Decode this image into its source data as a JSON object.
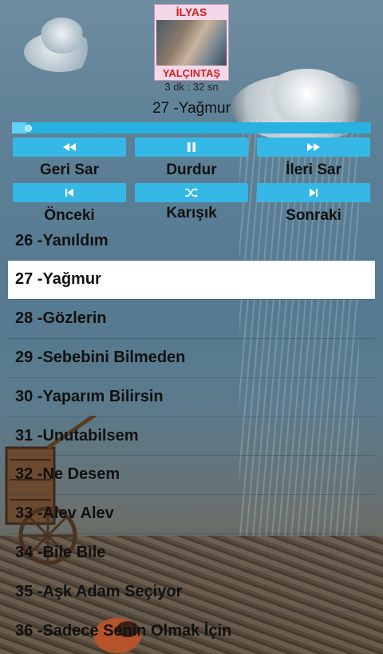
{
  "album": {
    "artist_line1": "İLYAS",
    "artist_line2": "YALÇINTAŞ"
  },
  "player": {
    "duration": "3 dk : 32 sn",
    "now_playing": "27 -Yağmur",
    "progress_fraction": 0.04
  },
  "controls": [
    {
      "label": "Geri Sar",
      "icon": "rewind-icon"
    },
    {
      "label": "Durdur",
      "icon": "pause-icon"
    },
    {
      "label": "İleri Sar",
      "icon": "fast-forward-icon"
    },
    {
      "label": "Önceki",
      "icon": "skip-previous-icon"
    },
    {
      "label": "Karışık",
      "icon": "shuffle-icon"
    },
    {
      "label": "Sonraki",
      "icon": "skip-next-icon"
    }
  ],
  "accent_color": "#35b8e6",
  "songs": [
    {
      "title": "26 -Yanıldım",
      "active": false
    },
    {
      "title": "27 -Yağmur",
      "active": true
    },
    {
      "title": "28 -Gözlerin",
      "active": false
    },
    {
      "title": "29 -Sebebini Bilmeden",
      "active": false
    },
    {
      "title": "30 -Yaparım Bilirsin",
      "active": false
    },
    {
      "title": "31 -Unutabilsem",
      "active": false
    },
    {
      "title": "32 -Ne Desem",
      "active": false
    },
    {
      "title": "33 -Alev Alev",
      "active": false
    },
    {
      "title": "34 -Bile Bile",
      "active": false
    },
    {
      "title": "35 -Aşk Adam Seçiyor",
      "active": false
    },
    {
      "title": "36 -Sadece Senin Olmak İçin",
      "active": false
    }
  ]
}
